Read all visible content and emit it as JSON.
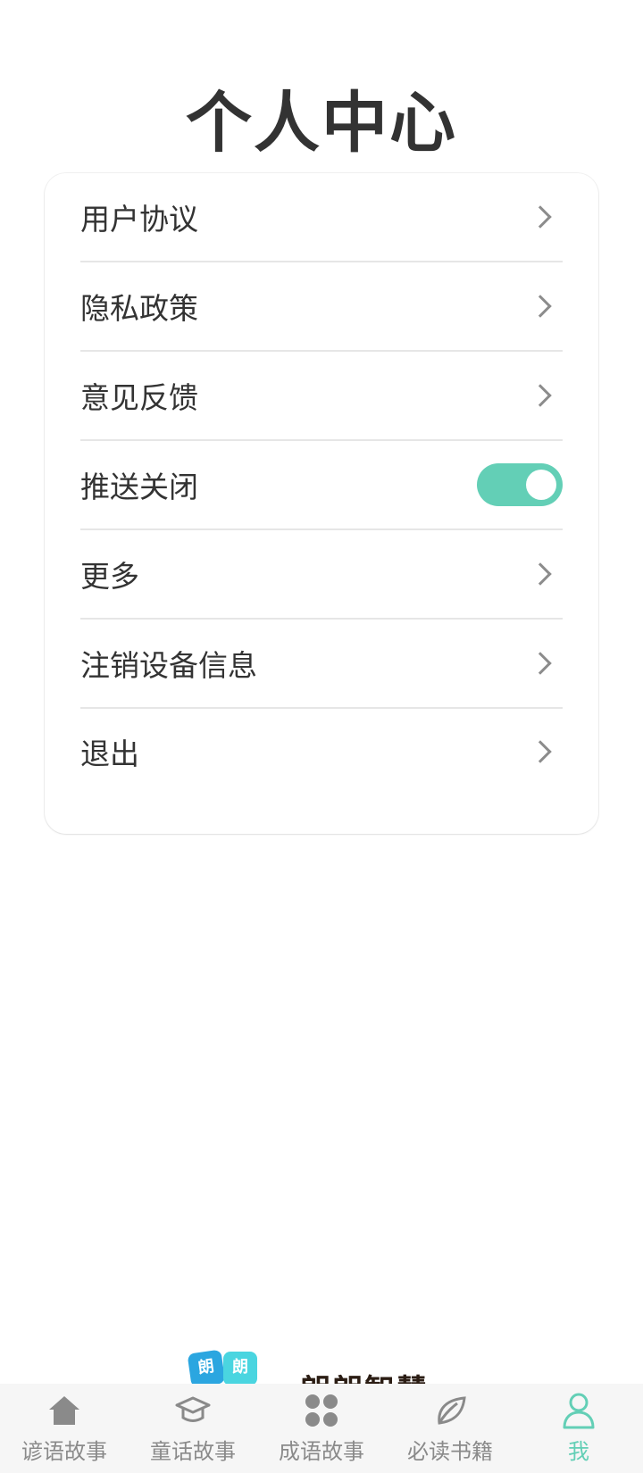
{
  "header": {
    "title": "个人中心"
  },
  "menu": {
    "items": [
      {
        "label": "用户协议",
        "control": "chevron"
      },
      {
        "label": "隐私政策",
        "control": "chevron"
      },
      {
        "label": "意见反馈",
        "control": "chevron"
      },
      {
        "label": "推送关闭",
        "control": "toggle",
        "toggle_on": true
      },
      {
        "label": "更多",
        "control": "chevron"
      },
      {
        "label": "注销设备信息",
        "control": "chevron"
      },
      {
        "label": "退出",
        "control": "chevron"
      }
    ]
  },
  "brand": {
    "logo_char_1": "朗",
    "logo_char_2": "朗",
    "name": "朗朗智慧"
  },
  "tabbar": {
    "tabs": [
      {
        "label": "谚语故事",
        "icon": "home-icon"
      },
      {
        "label": "童话故事",
        "icon": "graduation-cap-icon"
      },
      {
        "label": "成语故事",
        "icon": "grid-circles-icon"
      },
      {
        "label": "必读书籍",
        "icon": "leaf-icon"
      },
      {
        "label": "我",
        "icon": "person-icon",
        "active": true
      }
    ]
  },
  "colors": {
    "accent": "#63cfb6",
    "text": "#333333",
    "tab_inactive": "#8a8a8a",
    "divider": "#e6e6e6"
  }
}
